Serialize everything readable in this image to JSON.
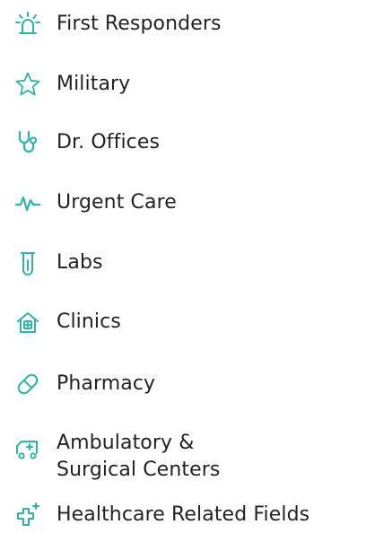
{
  "accent_color": "#2bb8a3",
  "items": [
    {
      "label": "First Responders",
      "icon": "siren-icon"
    },
    {
      "label": "Military",
      "icon": "star-icon"
    },
    {
      "label": "Dr. Offices",
      "icon": "stethoscope-icon"
    },
    {
      "label": "Urgent Care",
      "icon": "heartbeat-icon"
    },
    {
      "label": "Labs",
      "icon": "test-tube-icon"
    },
    {
      "label": "Clinics",
      "icon": "clinic-house-icon"
    },
    {
      "label": "Pharmacy",
      "icon": "pill-icon"
    },
    {
      "label": "Ambulatory & Surgical Centers",
      "icon": "ambulance-icon"
    },
    {
      "label": "Healthcare Related Fields",
      "icon": "medical-cross-icon"
    }
  ]
}
